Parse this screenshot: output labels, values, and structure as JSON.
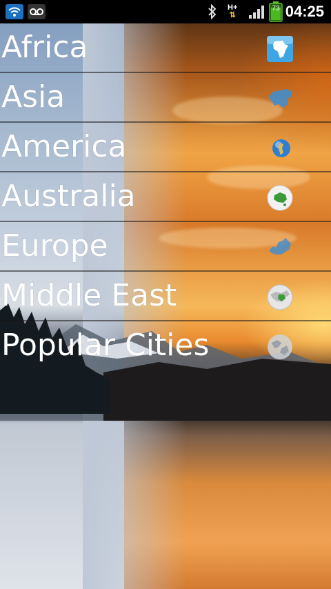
{
  "status_bar": {
    "time": "04:25",
    "battery_level": "73",
    "network": "H+",
    "icons": [
      "wifi-icon",
      "voicemail-icon",
      "bluetooth-icon",
      "network-type-icon",
      "signal-icon",
      "battery-icon"
    ]
  },
  "menu": {
    "items": [
      {
        "label": "Africa",
        "icon": "africa-map-icon"
      },
      {
        "label": "Asia",
        "icon": "asia-map-icon"
      },
      {
        "label": "America",
        "icon": "america-globe-icon"
      },
      {
        "label": "Australia",
        "icon": "australia-globe-icon"
      },
      {
        "label": "Europe",
        "icon": "europe-map-icon"
      },
      {
        "label": "Middle East",
        "icon": "middle-east-globe-icon"
      },
      {
        "label": "Popular Cities",
        "icon": "cities-globe-icon"
      }
    ]
  },
  "colors": {
    "status_bar_bg": "#000000",
    "text": "#ffffff",
    "icon_blue": "#3b8fd6",
    "sunset_orange": "#e88a2d"
  }
}
